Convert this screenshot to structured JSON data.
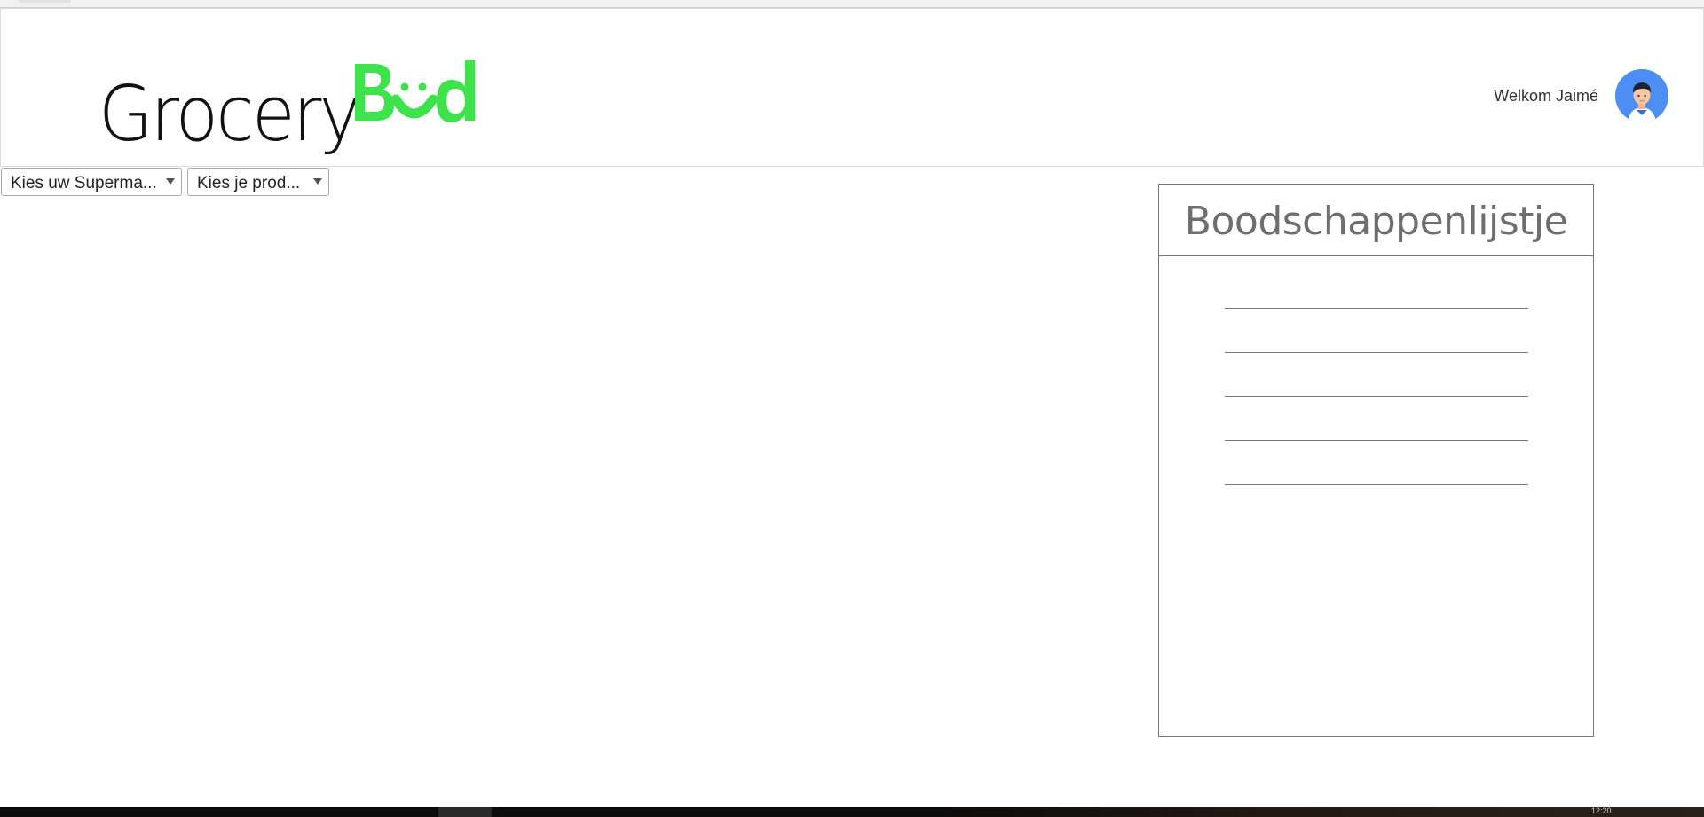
{
  "header": {
    "logo": {
      "part1": "Grocery",
      "part2": "Bud",
      "part2_color": "#3ee24a",
      "part1_color": "#111111"
    },
    "welcome_text": "Welkom Jaimé",
    "avatar_icon": "user-avatar-icon",
    "avatar_bg": "#4d8ef5"
  },
  "filters": {
    "supermarket_select": "Kies uw Superma...",
    "product_select": "Kies je prod..."
  },
  "shopping_list": {
    "title": "Boodschappenlijstje",
    "items": [
      "",
      "",
      "",
      "",
      ""
    ]
  },
  "taskbar": {
    "clock": "12:20"
  }
}
